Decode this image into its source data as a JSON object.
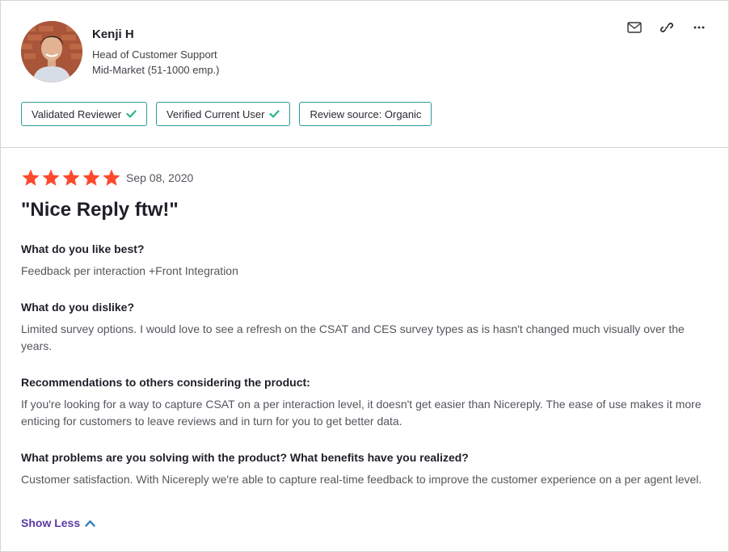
{
  "reviewer": {
    "name": "Kenji H",
    "title": "Head of Customer Support",
    "segment": "Mid-Market (51-1000 emp.)"
  },
  "actions": [
    {
      "icon": "envelope-icon"
    },
    {
      "icon": "link-icon"
    },
    {
      "icon": "more-horizontal-icon"
    }
  ],
  "badges": [
    {
      "label": "Validated Reviewer",
      "checked": true
    },
    {
      "label": "Verified Current User",
      "checked": true
    },
    {
      "label": "Review source: Organic",
      "checked": false
    }
  ],
  "review": {
    "rating": 5,
    "max_rating": 5,
    "date": "Sep 08, 2020",
    "title": "\"Nice Reply ftw!\"",
    "qa": [
      {
        "q": "What do you like best?",
        "a": "Feedback per interaction +Front Integration"
      },
      {
        "q": "What do you dislike?",
        "a": "Limited survey options. I would love to see a refresh on the CSAT and CES survey types as is hasn't changed much visually over the years."
      },
      {
        "q": "Recommendations to others considering the product:",
        "a": "If you're looking for a way to capture CSAT on a per interaction level, it doesn't get easier than Nicereply. The ease of use makes it more enticing for customers to leave reviews and in turn for you to get better data."
      },
      {
        "q": "What problems are you solving with the product? What benefits have you realized?",
        "a": "Customer satisfaction. With Nicereply we're able to capture real-time feedback to improve the customer experience on a per agent level."
      }
    ],
    "show_less_label": "Show Less"
  },
  "colors": {
    "star": "#ff492c",
    "badge_border": "#2d9c9a",
    "check": "#27b48a",
    "link": "#5a39a2",
    "chevron": "#2d7fbf"
  }
}
